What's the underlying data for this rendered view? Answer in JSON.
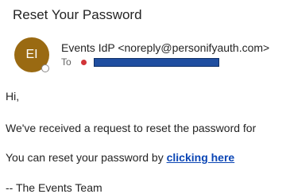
{
  "email": {
    "subject": "Reset Your Password",
    "avatar_initials": "EI",
    "sender": "Events IdP <noreply@personifyauth.com>",
    "to_label": "To",
    "greeting": "Hi,",
    "line1": "We've received a request to reset the password for",
    "line2_prefix": "You can reset your password by ",
    "link_text": "clicking here",
    "signature": "-- The Events Team"
  },
  "colors": {
    "avatar_bg": "#9a6a12",
    "link": "#0b46b5",
    "redaction": "#1f4ea0",
    "status_dot": "#d13438"
  }
}
